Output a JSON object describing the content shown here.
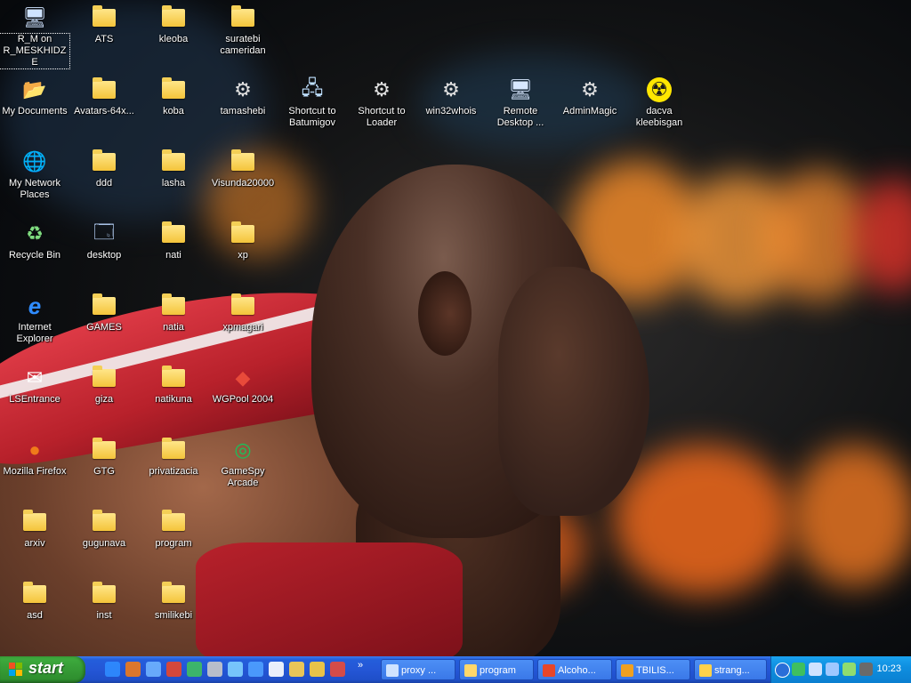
{
  "desktop": {
    "icons": [
      {
        "label": "R_M on R_MESKHIDZE",
        "type": "computer",
        "selected": true
      },
      {
        "label": "ATS",
        "type": "folder"
      },
      {
        "label": "kleoba",
        "type": "folder"
      },
      {
        "label": "suratebi cameridan",
        "type": "folder"
      },
      {
        "label": "My Documents",
        "type": "documents"
      },
      {
        "label": "Avatars-64x...",
        "type": "folder"
      },
      {
        "label": "koba",
        "type": "folder"
      },
      {
        "label": "tamashebi",
        "type": "program"
      },
      {
        "label": "Shortcut to Batumigov",
        "type": "network"
      },
      {
        "label": "Shortcut to Loader",
        "type": "program"
      },
      {
        "label": "win32whois",
        "type": "program"
      },
      {
        "label": "Remote Desktop ...",
        "type": "remote"
      },
      {
        "label": "AdminMagic",
        "type": "program"
      },
      {
        "label": "dacva kleebisgan",
        "type": "radiation"
      },
      {
        "label": "My Network Places",
        "type": "network-places"
      },
      {
        "label": "ddd",
        "type": "folder"
      },
      {
        "label": "lasha",
        "type": "folder"
      },
      {
        "label": "Visunda20000",
        "type": "folder"
      },
      {
        "label": "Recycle Bin",
        "type": "recycle"
      },
      {
        "label": "desktop",
        "type": "desktop"
      },
      {
        "label": "nati",
        "type": "folder"
      },
      {
        "label": "xp",
        "type": "folder"
      },
      {
        "label": "Internet Explorer",
        "type": "ie"
      },
      {
        "label": "GAMES",
        "type": "folder"
      },
      {
        "label": "natia",
        "type": "folder"
      },
      {
        "label": "xpmagari",
        "type": "folder"
      },
      {
        "label": "LSEntrance",
        "type": "mail"
      },
      {
        "label": "giza",
        "type": "folder"
      },
      {
        "label": "natikuna",
        "type": "folder"
      },
      {
        "label": "WGPool 2004",
        "type": "pool"
      },
      {
        "label": "Mozilla Firefox",
        "type": "firefox"
      },
      {
        "label": "GTG",
        "type": "folder"
      },
      {
        "label": "privatizacia",
        "type": "folder"
      },
      {
        "label": "GameSpy Arcade",
        "type": "gamespy"
      },
      {
        "label": "arxiv",
        "type": "folder"
      },
      {
        "label": "gugunava",
        "type": "folder"
      },
      {
        "label": "program",
        "type": "folder"
      },
      {
        "label": "asd",
        "type": "folder"
      },
      {
        "label": "inst",
        "type": "folder"
      },
      {
        "label": "smilikebi",
        "type": "folder"
      }
    ]
  },
  "taskbar": {
    "start_label": "start",
    "quicklaunch_more": "»",
    "quicklaunch_icons": [
      "ie-icon",
      "firefox-icon",
      "messenger-icon",
      "opera-icon",
      "media-icon",
      "winamp-icon",
      "tv-icon",
      "update-icon",
      "player-icon",
      "notepad-icon",
      "mail-icon",
      "opera-mail-icon"
    ],
    "tasks": [
      {
        "label": "proxy ...",
        "icon": "gear-icon"
      },
      {
        "label": "program",
        "icon": "folder-icon"
      },
      {
        "label": "Alcoho...",
        "icon": "alcohol-icon"
      },
      {
        "label": "TBILIS...",
        "icon": "opera-icon"
      },
      {
        "label": "strang...",
        "icon": "window-icon"
      }
    ],
    "tray": {
      "clock": "10:23",
      "icons": [
        "show-hidden-icon",
        "messenger-icon",
        "network-icon",
        "monitor-icon",
        "people-icon",
        "shield-icon"
      ]
    }
  }
}
